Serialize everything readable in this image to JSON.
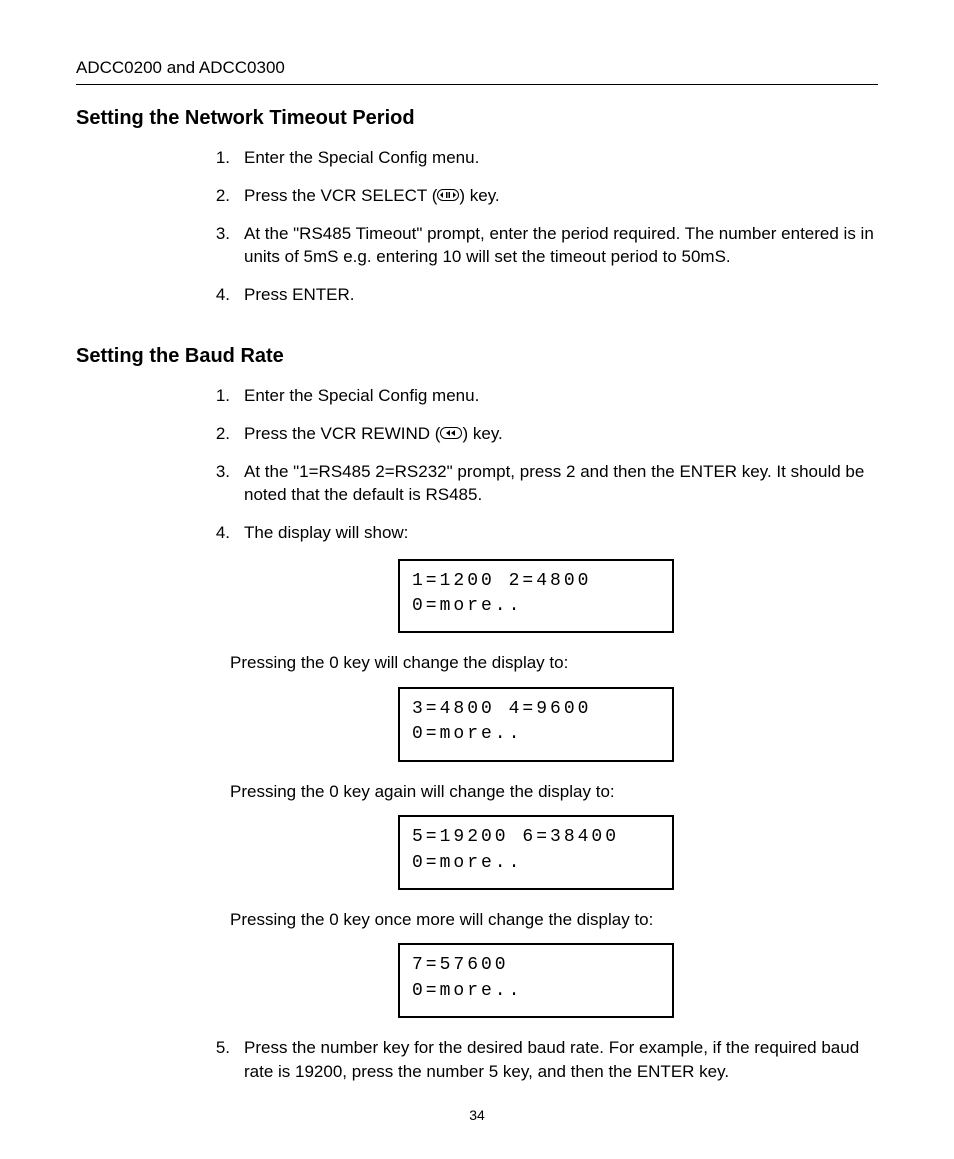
{
  "header": {
    "running": "ADCC0200 and ADCC0300"
  },
  "section1": {
    "title": "Setting the Network Timeout Period",
    "steps": [
      {
        "n": "1.",
        "text": "Enter the Special Config menu."
      },
      {
        "n": "2.",
        "pre": "Press the VCR SELECT (",
        "icon": "play-pause-key-icon",
        "post": ") key."
      },
      {
        "n": "3.",
        "text": "At the \"RS485 Timeout\" prompt, enter the period required. The number entered is in units of 5mS e.g. entering 10 will set the timeout period to 50mS."
      },
      {
        "n": "4.",
        "text": "Press ENTER."
      }
    ]
  },
  "section2": {
    "title": "Setting the Baud Rate",
    "steps": [
      {
        "n": "1.",
        "text": "Enter the Special Config menu."
      },
      {
        "n": "2.",
        "pre": "Press the VCR REWIND (",
        "icon": "rewind-key-icon",
        "post": ") key."
      },
      {
        "n": "3.",
        "text": "At the \"1=RS485 2=RS232\" prompt, press 2 and then the ENTER key. It should be noted that the default is RS485."
      },
      {
        "n": "4.",
        "text": "The display will show:"
      }
    ],
    "display_a": {
      "line1": "1=1200 2=4800",
      "line2": "0=more.."
    },
    "para_b": "Pressing the 0 key will change the display to:",
    "display_b": {
      "line1": "3=4800 4=9600",
      "line2": "0=more.."
    },
    "para_c": "Pressing the 0 key again will change the display to:",
    "display_c": {
      "line1": "5=19200 6=38400",
      "line2": "0=more.."
    },
    "para_d": "Pressing the 0 key once more will change the display to:",
    "display_d": {
      "line1": "7=57600",
      "line2": "0=more.."
    },
    "step5": {
      "n": "5.",
      "text": "Press the number key for the desired baud rate. For example, if the required baud rate is 19200, press the number 5 key, and then the ENTER key."
    }
  },
  "page_number": "34"
}
